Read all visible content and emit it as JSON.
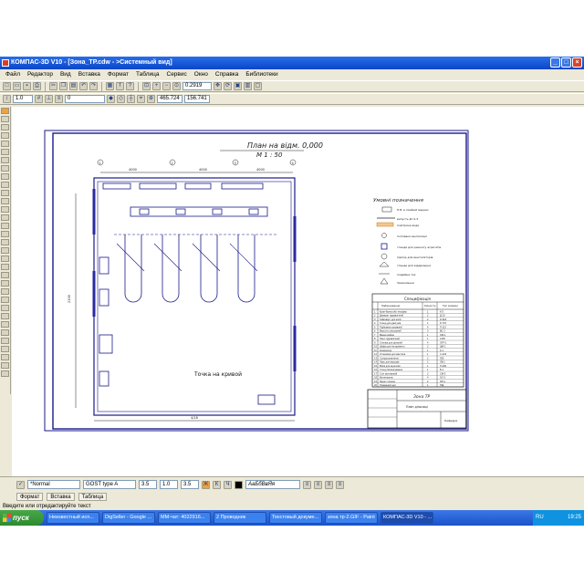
{
  "window": {
    "title": "КОМПАС-3D V10 - [Зона_ТР.cdw - >Системный вид]"
  },
  "menu": {
    "items": [
      "Файл",
      "Редактор",
      "Вид",
      "Вставка",
      "Формат",
      "Таблица",
      "Сервис",
      "Окно",
      "Справка",
      "Библиотеки"
    ]
  },
  "toolbar": {
    "zoom_value": "0.2919",
    "line_step": "1.0",
    "layer_value": "0",
    "coord_x": "465.724",
    "coord_y": "156.741"
  },
  "drawing": {
    "plan_title": "План на відм. 0,000",
    "plan_scale": "М 1 : 50",
    "dims_top": [
      "4000",
      "4000",
      "4000"
    ],
    "dim_left": "2100",
    "dim_bottom": "4/18",
    "axes_top": [
      "1",
      "2",
      "3",
      "4"
    ],
    "cursor_hint": "Точка на кривой",
    "legend_title": "Умовні позначення",
    "legend_items": [
      "Н.В. в лінійній мережі",
      "випусть ф=1,5",
      "повітряна вода",
      "поплавки вентиляції",
      "стенди для ремонту агрегатів",
      "підпор для вентиляторів",
      "стенди для віддалення",
      "подвійна тех",
      "Заземлення"
    ],
    "spec_title": "Специфікація",
    "spec_headers": [
      "Найменування",
      "Кількість",
      "Тип заливки"
    ],
    "spec_rows": [
      [
        "Кран-балка або тельфер",
        "1",
        "К-5"
      ],
      [
        "Домкрат гідравлічний",
        "2",
        "Д-10"
      ],
      [
        "Гайковерт для коліс",
        "2",
        "И-318"
      ],
      [
        "Стенд для двигунів",
        "1",
        "Р-776"
      ],
      [
        "Підйомник канавний",
        "4",
        "П-113"
      ],
      [
        "Верстат слюсарний",
        "3",
        "ВС-1"
      ],
      [
        "Ванна мийна",
        "1",
        "ОМ-1"
      ],
      [
        "Прес гідравлічний",
        "1",
        "2135"
      ],
      [
        "Стелаж для деталей",
        "4",
        "ОРГ-1"
      ],
      [
        "Шафа для інструменту",
        "2",
        "ШИ-1"
      ],
      [
        "Компресор",
        "1",
        "К-1"
      ],
      [
        "Установка для мастила",
        "1",
        "С-223"
      ],
      [
        "Солідолонагнітач",
        "2",
        "390"
      ],
      [
        "Ларь для відходів",
        "2",
        "ЛВ-1"
      ],
      [
        "Візок для агрегатів",
        "1",
        "П-206"
      ],
      [
        "Стенд балансування",
        "1",
        "Б-1"
      ],
      [
        "Стіл монтажний",
        "2",
        "СМ-3"
      ],
      [
        "Вогнегасник",
        "4",
        "ОУ-2"
      ],
      [
        "Ящик з піском",
        "2",
        "ЯП-1"
      ],
      [
        "Пожежний щит",
        "1",
        "ПЩ"
      ]
    ],
    "stamp_title": "Зона ТР",
    "stamp_sub": "План дільниці",
    "stamp_org": "Кафедра"
  },
  "properties": {
    "style": "*Normal",
    "font": "GOST type A",
    "height": "3.5",
    "scale": "1.0",
    "spacing": "3.5",
    "preview": "АаБбВвЯя",
    "tabs": [
      "Формат",
      "Вставка",
      "Таблица"
    ]
  },
  "status": {
    "message": "Введите или отредактируйте текст"
  },
  "taskbar": {
    "start_label": "пуск",
    "buttons": [
      "Неизвестный исп...",
      "DigSeller - Google ...",
      "ММ-чат: 4022916...",
      "2 Проводник",
      "Текстовый докуме...",
      "зона тр-2.GIF - Paint",
      "КОМПАС-3D V10 - ..."
    ],
    "active_index": 6,
    "lang": "RU",
    "clock": "19:25"
  },
  "colors": {
    "titlebar": "#0a46c8",
    "drawing_line": "#1a1a8c",
    "taskbar": "#1b52c8",
    "start": "#2e8a2e"
  }
}
